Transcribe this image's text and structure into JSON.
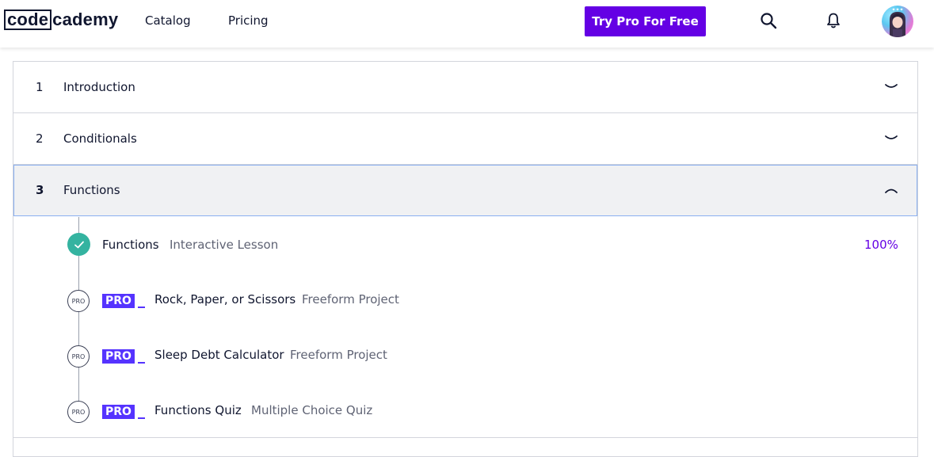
{
  "header": {
    "logo_boxed": "code",
    "logo_rest": "cademy",
    "nav": [
      {
        "label": "Catalog"
      },
      {
        "label": "Pricing"
      }
    ],
    "cta_label": "Try Pro For Free",
    "icons": [
      "search-icon",
      "bell-icon"
    ],
    "accent_color": "#6400e4"
  },
  "modules": [
    {
      "number": "1",
      "title": "Introduction",
      "expanded": false,
      "chevron": "chevron-down-icon"
    },
    {
      "number": "2",
      "title": "Conditionals",
      "expanded": false,
      "chevron": "chevron-down-icon"
    },
    {
      "number": "3",
      "title": "Functions",
      "expanded": true,
      "chevron": "chevron-up-icon"
    }
  ],
  "lessons": [
    {
      "title": "Functions",
      "type": "Interactive Lesson",
      "status": "completed",
      "progress": "100%"
    },
    {
      "pro_badge": "PRO",
      "status_icon_text": "PRO",
      "title": "Rock, Paper, or Scissors",
      "type": "Freeform Project"
    },
    {
      "pro_badge": "PRO",
      "status_icon_text": "PRO",
      "title": "Sleep Debt Calculator",
      "type": "Freeform Project"
    },
    {
      "pro_badge": "PRO",
      "status_icon_text": "PRO",
      "title": "Functions Quiz",
      "type": "Multiple Choice Quiz"
    }
  ],
  "colors": {
    "completed": "#34b3a0",
    "pro_badge": "#5533ff",
    "progress_text": "#6400e4",
    "selected_outline": "#8ab0f0"
  }
}
